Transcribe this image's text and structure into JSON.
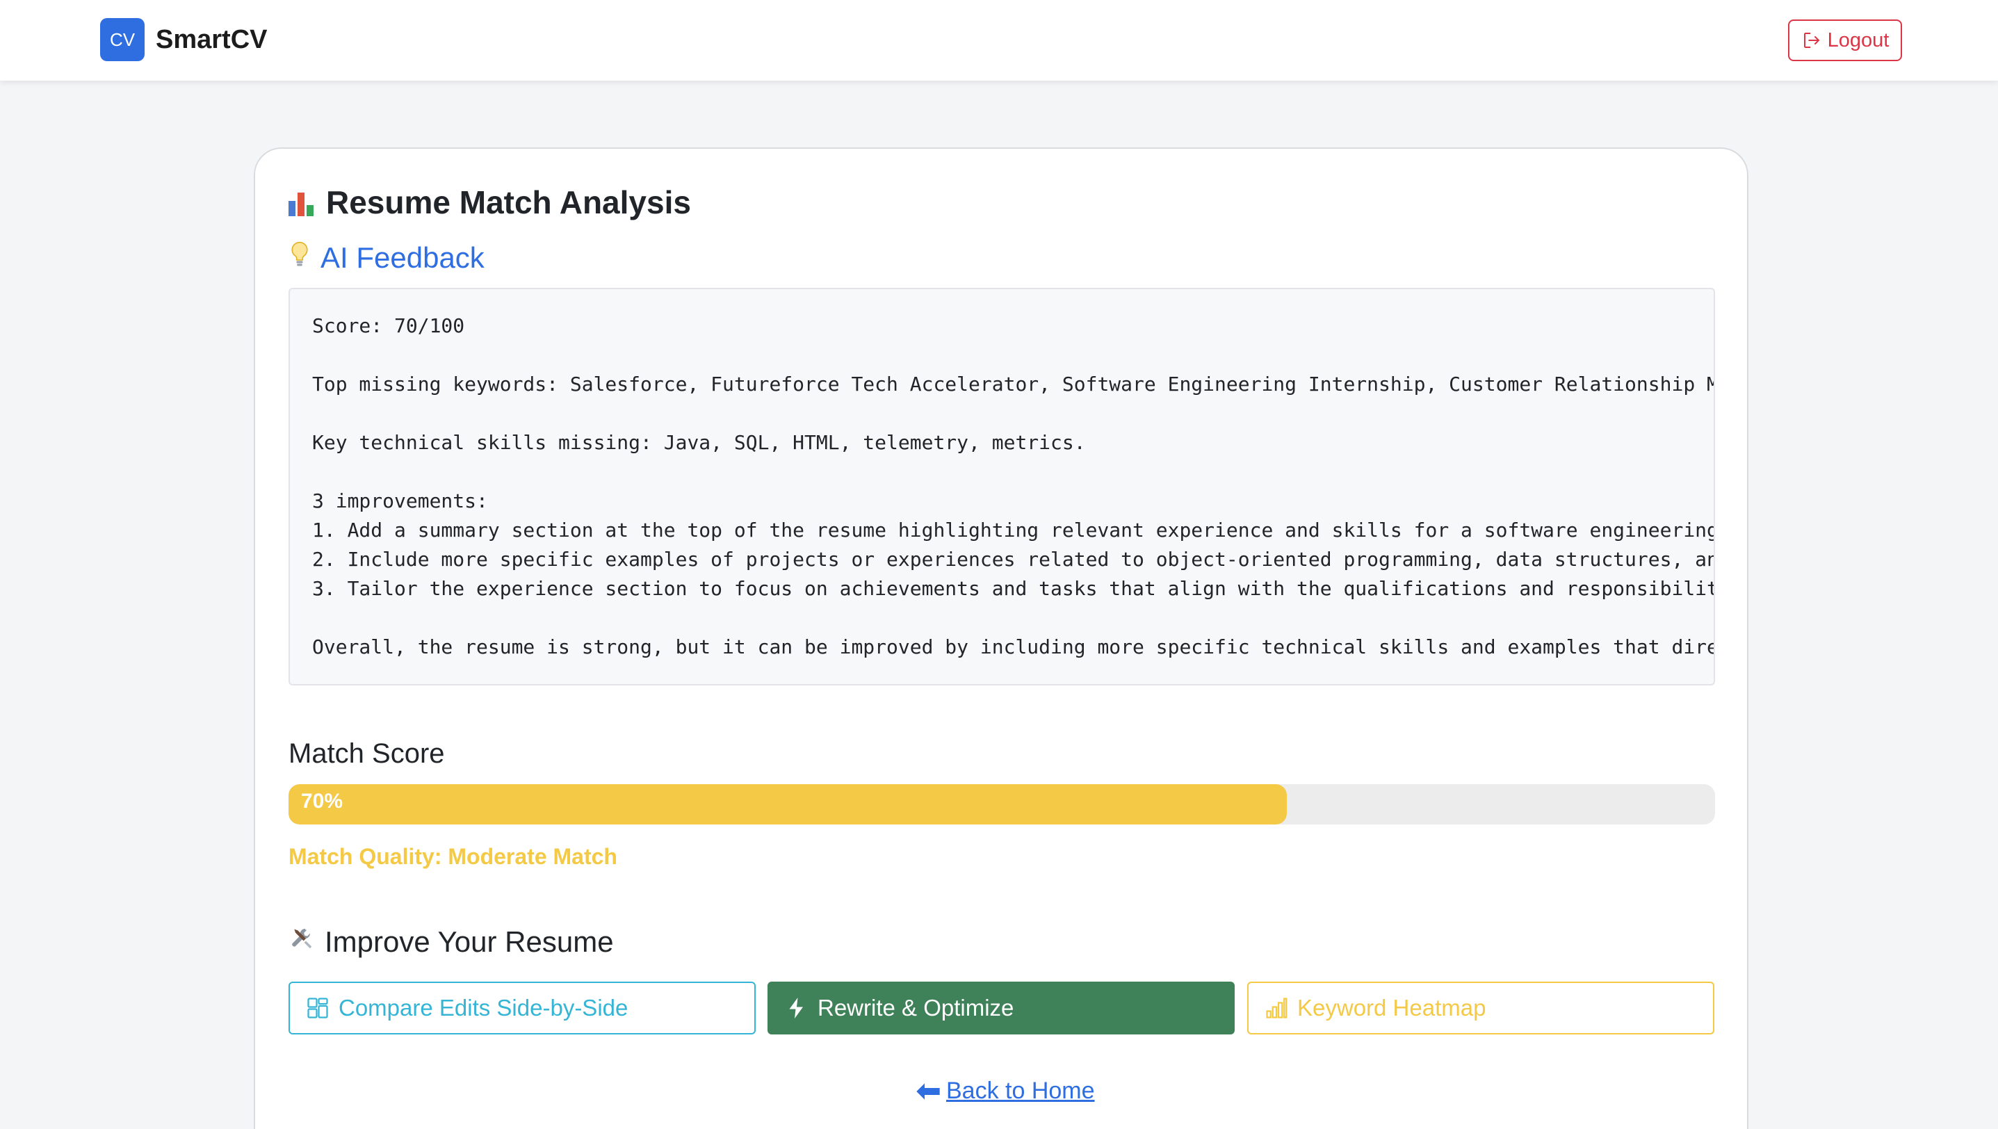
{
  "navbar": {
    "logo_text": "CV",
    "brand_name": "SmartCV",
    "logout_label": "Logout",
    "logout_icon": "logout-icon"
  },
  "card": {
    "title": "Resume Match Analysis",
    "title_icon": "bar-chart-icon",
    "subtitle": "AI Feedback",
    "subtitle_icon": "lightbulb-icon",
    "feedback": {
      "score_line": "Score: 70/100",
      "missing_keywords_line": "Top missing keywords: Salesforce, Futureforce Tech Accelerator, Software Engineering Internship, Customer Relationship M",
      "missing_skills_line": "Key technical skills missing: Java, SQL, HTML, telemetry, metrics.",
      "improvements_heading": "3 improvements:",
      "improvement_1": "1. Add a summary section at the top of the resume highlighting relevant experience and skills for a software engineering",
      "improvement_2": "2. Include more specific examples of projects or experiences related to object-oriented programming, data structures, an",
      "improvement_3": "3. Tailor the experience section to focus on achievements and tasks that align with the qualifications and responsibilit",
      "overall_line": "Overall, the resume is strong, but it can be improved by including more specific technical skills and examples that dire"
    },
    "match_score_label": "Match Score",
    "match_score_percent": 70,
    "match_score_text": "70%",
    "match_quality": "Match Quality: Moderate Match",
    "improve_title": "Improve Your Resume",
    "improve_icon": "tools-icon",
    "buttons": {
      "compare": "Compare Edits Side-by-Side",
      "rewrite": "Rewrite & Optimize",
      "heatmap": "Keyword Heatmap"
    },
    "back_link": "Back to Home",
    "back_icon": "left-arrow-icon"
  },
  "colors": {
    "primary": "#2f6ee0",
    "danger": "#dc3545",
    "warning": "#f4c945",
    "info": "#34b5d6",
    "success": "#3f8158"
  }
}
